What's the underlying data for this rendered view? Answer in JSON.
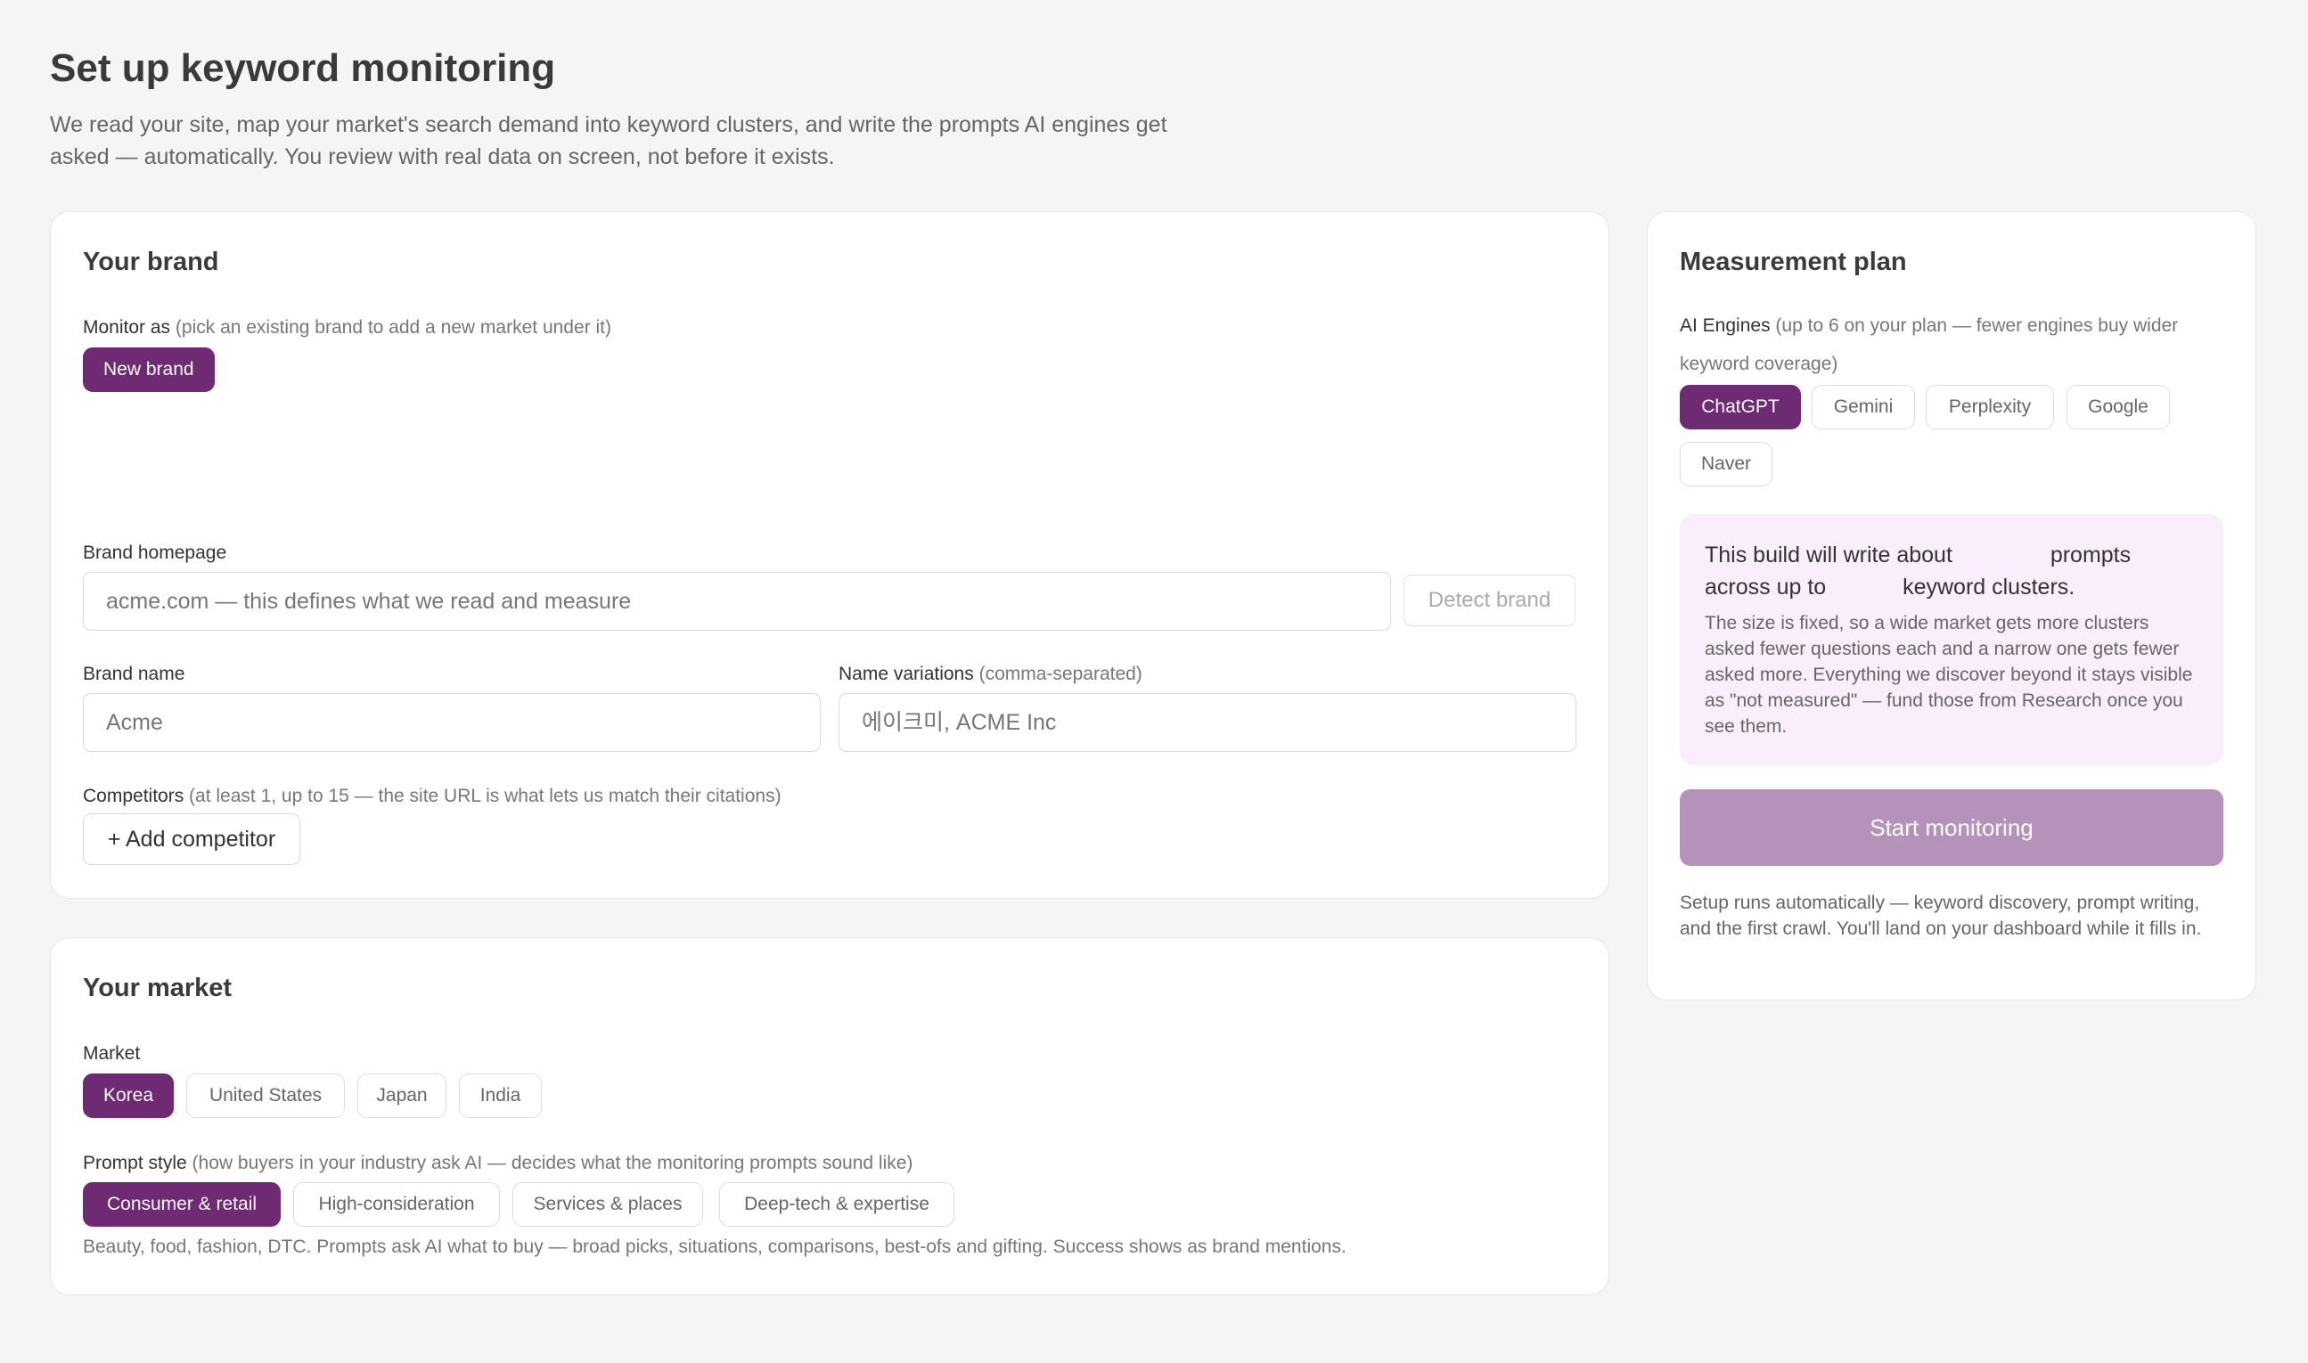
{
  "page": {
    "title": "Set up keyword monitoring",
    "subtitle": "We read your site, map your market's search demand into keyword clusters, and write the prompts AI engines get asked — automatically. You review with real data on screen, not before it exists."
  },
  "brand": {
    "title": "Your brand",
    "monitor_as_label": "Monitor as",
    "monitor_as_hint": "(pick an existing brand to add a new market under it)",
    "new_brand_chip": "New brand",
    "homepage_label": "Brand homepage",
    "homepage_placeholder": "acme.com — this defines what we read and measure",
    "detect_button": "Detect brand",
    "name_label": "Brand name",
    "name_placeholder": "Acme",
    "variations_label": "Name variations",
    "variations_hint": "(comma-separated)",
    "variations_placeholder": "에이크미, ACME Inc",
    "competitors_label": "Competitors",
    "competitors_hint": "(at least 1, up to 15 — the site URL is what lets us match their citations)",
    "add_competitor_button": "+ Add competitor"
  },
  "market": {
    "title": "Your market",
    "market_label": "Market",
    "markets": [
      "Korea",
      "United States",
      "Japan",
      "India"
    ],
    "selected_market": "Korea",
    "prompt_style_label": "Prompt style",
    "prompt_style_hint": "(how buyers in your industry ask AI — decides what the monitoring prompts sound like)",
    "prompt_styles": [
      "Consumer & retail",
      "High-consideration",
      "Services & places",
      "Deep-tech & expertise"
    ],
    "selected_prompt_style": "Consumer & retail",
    "style_description": "Beauty, food, fashion, DTC. Prompts ask AI what to buy — broad picks, situations, comparisons, best-ofs and gifting. Success shows as brand mentions."
  },
  "plan": {
    "title": "Measurement plan",
    "engines_label": "AI Engines",
    "engines_hint": "(up to 6 on your plan — fewer engines buy wider keyword coverage)",
    "engines": [
      "ChatGPT",
      "Gemini",
      "Perplexity",
      "Google",
      "Naver"
    ],
    "selected_engine": "ChatGPT",
    "info_line1_a": "This build will write about",
    "info_line1_b": "prompts",
    "info_line2_a": "across up to",
    "info_line2_b": "keyword clusters.",
    "info_body": "The size is fixed, so a wide market gets more clusters asked fewer questions each and a narrow one gets fewer asked more. Everything we discover beyond it stays visible as \"not measured\" — fund those from Research once you see them.",
    "start_button": "Start monitoring",
    "footer_note": "Setup runs automatically — keyword discovery, prompt writing, and the first crawl. You'll land on your dashboard while it fills in."
  },
  "colors": {
    "accent": "#6e2a72",
    "accent_disabled": "#b592ba",
    "info_bg": "#fbeefc",
    "page_bg": "#f5f5f5"
  }
}
